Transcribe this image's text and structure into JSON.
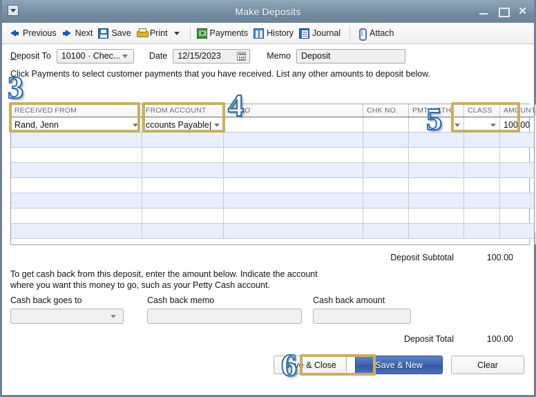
{
  "window": {
    "title": "Make Deposits",
    "sysmenu_icon": "window-menu-icon",
    "minimize_label": "Minimize",
    "maximize_label": "Maximize",
    "close_label": "Close"
  },
  "toolbar": {
    "items": [
      {
        "label": "Previous",
        "icon": "arrow-left-icon"
      },
      {
        "label": "Next",
        "icon": "arrow-right-icon"
      },
      {
        "label": "Save",
        "icon": "save-disk-icon"
      },
      {
        "label": "Print",
        "icon": "printer-icon"
      },
      {
        "label": "Payments",
        "icon": "payments-money-icon"
      },
      {
        "label": "History",
        "icon": "history-book-icon"
      },
      {
        "label": "Journal",
        "icon": "journal-icon"
      },
      {
        "label": "Attach",
        "icon": "paperclip-icon"
      }
    ],
    "print_dropdown_icon": "chevron-down-icon"
  },
  "form": {
    "deposit_to_label": "Deposit To",
    "deposit_to_value": "10100 · Chec...",
    "date_label": "Date",
    "date_value": "12/15/2023",
    "calendar_icon": "calendar-icon",
    "memo_label": "Memo",
    "memo_value": "Deposit"
  },
  "instruction": "Click Payments to select customer payments that you have received. List any other amounts to deposit below.",
  "table": {
    "headers": [
      "RECEIVED FROM",
      "FROM ACCOUNT",
      "MEMO",
      "CHK NO.",
      "PMT METH.",
      "CLASS",
      "AMOUNT"
    ],
    "rows": [
      {
        "received_from": "Rand, Jenn",
        "from_account": "ccounts Payable",
        "memo": "",
        "chk_no": "",
        "pmt_meth": "",
        "class": "",
        "amount": "100.00"
      }
    ],
    "empty_row_count": 7,
    "scroll_up_icon": "scroll-up-arrow-icon",
    "scroll_down_icon": "scroll-down-arrow-icon"
  },
  "totals": {
    "subtotal_label": "Deposit Subtotal",
    "subtotal_value": "100.00",
    "total_label": "Deposit Total",
    "total_value": "100.00"
  },
  "cash_back": {
    "description_line1": "To get cash back from this deposit, enter the amount below.  Indicate the account",
    "description_line2": "where you want this money to go, such as your Petty Cash account.",
    "goes_to_label": "Cash back goes to",
    "goes_to_value": "",
    "memo_label": "Cash back memo",
    "memo_value": "",
    "amount_label": "Cash back amount",
    "amount_value": ""
  },
  "footer": {
    "save_close_label": "Save & Close",
    "save_new_label": "Save & New",
    "clear_label": "Clear"
  },
  "callouts": {
    "step3": "3",
    "step4": "4",
    "step5": "5",
    "step6": "6"
  },
  "colors": {
    "titlebar": "#7d94a8",
    "highlight_gold": "#c9ae61",
    "primary_button": "#3f63ad",
    "row_alt": "#e8eefc",
    "callout_blue": "#2e6ca8"
  }
}
